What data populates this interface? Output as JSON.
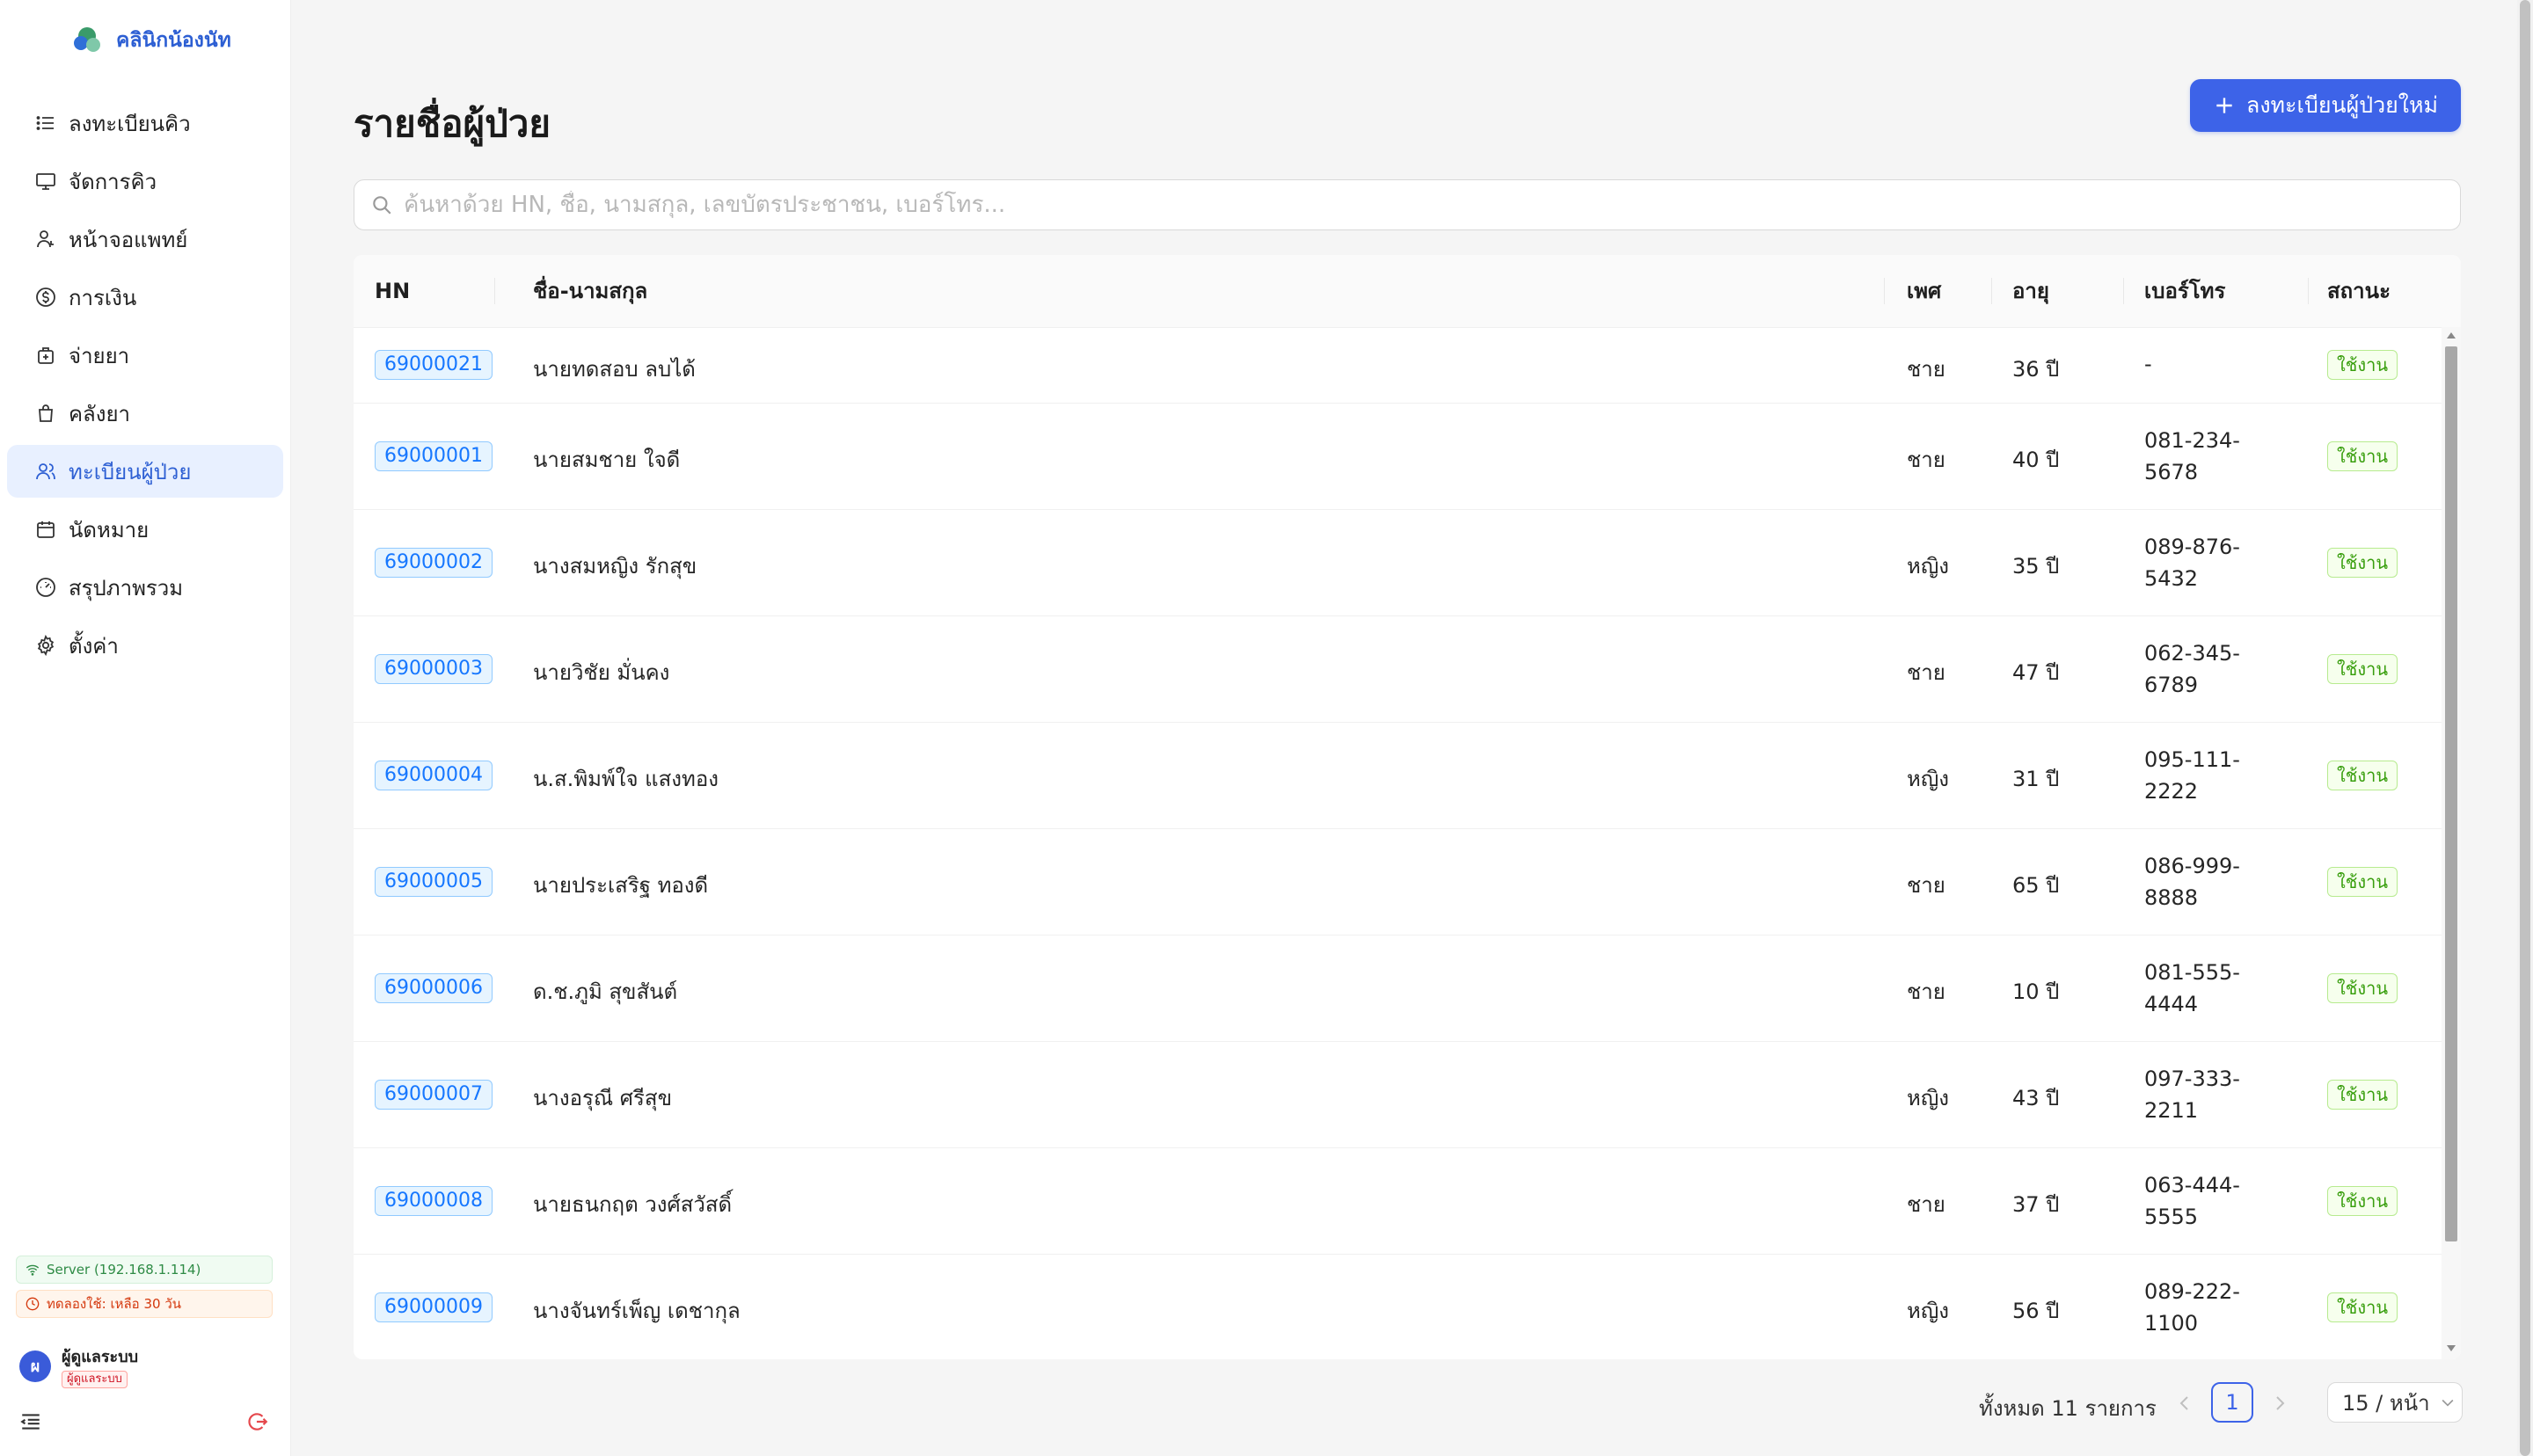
{
  "sidebar": {
    "logo_text": "คลินิกน้องนัท",
    "menu": [
      {
        "label": "ลงทะเบียนคิว",
        "icon": "list-icon",
        "active": false
      },
      {
        "label": "จัดการคิว",
        "icon": "monitor-icon",
        "active": false
      },
      {
        "label": "หน้าจอแพทย์",
        "icon": "doctor-icon",
        "active": false
      },
      {
        "label": "การเงิน",
        "icon": "dollar-icon",
        "active": false
      },
      {
        "label": "จ่ายยา",
        "icon": "medicine-bag-icon",
        "active": false
      },
      {
        "label": "คลังยา",
        "icon": "shopping-bag-icon",
        "active": false
      },
      {
        "label": "ทะเบียนผู้ป่วย",
        "icon": "users-icon",
        "active": true
      },
      {
        "label": "นัดหมาย",
        "icon": "calendar-icon",
        "active": false
      },
      {
        "label": "สรุปภาพรวม",
        "icon": "dashboard-icon",
        "active": false
      },
      {
        "label": "ตั้งค่า",
        "icon": "gear-icon",
        "active": false
      }
    ],
    "server_text": "Server (192.168.1.114)",
    "trial_text": "ทดลองใช้: เหลือ 30 วัน",
    "user": {
      "initial": "ผ",
      "name": "ผู้ดูแลระบบ",
      "role": "ผู้ดูแลระบบ"
    }
  },
  "header": {
    "title": "รายชื่อผู้ป่วย",
    "add_button_label": "ลงทะเบียนผู้ป่วยใหม่"
  },
  "search": {
    "placeholder": "ค้นหาด้วย HN, ชื่อ, นามสกุล, เลขบัตรประชาชน, เบอร์โทร...",
    "value": ""
  },
  "table": {
    "columns": [
      "HN",
      "ชื่อ-นามสกุล",
      "เพศ",
      "อายุ",
      "เบอร์โทร",
      "สถานะ"
    ],
    "rows": [
      {
        "hn": "69000021",
        "name": "นายทดสอบ ลบได้",
        "gender": "ชาย",
        "age": "36 ปี",
        "phone1": "-",
        "phone2": "",
        "status": "ใช้งาน"
      },
      {
        "hn": "69000001",
        "name": "นายสมชาย ใจดี",
        "gender": "ชาย",
        "age": "40 ปี",
        "phone1": "081-234-",
        "phone2": "5678",
        "status": "ใช้งาน"
      },
      {
        "hn": "69000002",
        "name": "นางสมหญิง รักสุข",
        "gender": "หญิง",
        "age": "35 ปี",
        "phone1": "089-876-",
        "phone2": "5432",
        "status": "ใช้งาน"
      },
      {
        "hn": "69000003",
        "name": "นายวิชัย มั่นคง",
        "gender": "ชาย",
        "age": "47 ปี",
        "phone1": "062-345-",
        "phone2": "6789",
        "status": "ใช้งาน"
      },
      {
        "hn": "69000004",
        "name": "น.ส.พิมพ์ใจ แสงทอง",
        "gender": "หญิง",
        "age": "31 ปี",
        "phone1": "095-111-",
        "phone2": "2222",
        "status": "ใช้งาน"
      },
      {
        "hn": "69000005",
        "name": "นายประเสริฐ ทองดี",
        "gender": "ชาย",
        "age": "65 ปี",
        "phone1": "086-999-",
        "phone2": "8888",
        "status": "ใช้งาน"
      },
      {
        "hn": "69000006",
        "name": "ด.ช.ภูมิ สุขสันต์",
        "gender": "ชาย",
        "age": "10 ปี",
        "phone1": "081-555-",
        "phone2": "4444",
        "status": "ใช้งาน"
      },
      {
        "hn": "69000007",
        "name": "นางอรุณี ศรีสุข",
        "gender": "หญิง",
        "age": "43 ปี",
        "phone1": "097-333-",
        "phone2": "2211",
        "status": "ใช้งาน"
      },
      {
        "hn": "69000008",
        "name": "นายธนกฤต วงศ์สวัสดิ์",
        "gender": "ชาย",
        "age": "37 ปี",
        "phone1": "063-444-",
        "phone2": "5555",
        "status": "ใช้งาน"
      },
      {
        "hn": "69000009",
        "name": "นางจันทร์เพ็ญ เดชากุล",
        "gender": "หญิง",
        "age": "56 ปี",
        "phone1": "089-222-",
        "phone2": "1100",
        "status": "ใช้งาน"
      }
    ]
  },
  "pagination": {
    "total_text": "ทั้งหมด 11 รายการ",
    "current_page": "1",
    "page_size": "15 / หน้า"
  },
  "colors": {
    "primary": "#3d63e8",
    "hn_tag": "#1677ff",
    "status_tag": "#389e0d"
  }
}
